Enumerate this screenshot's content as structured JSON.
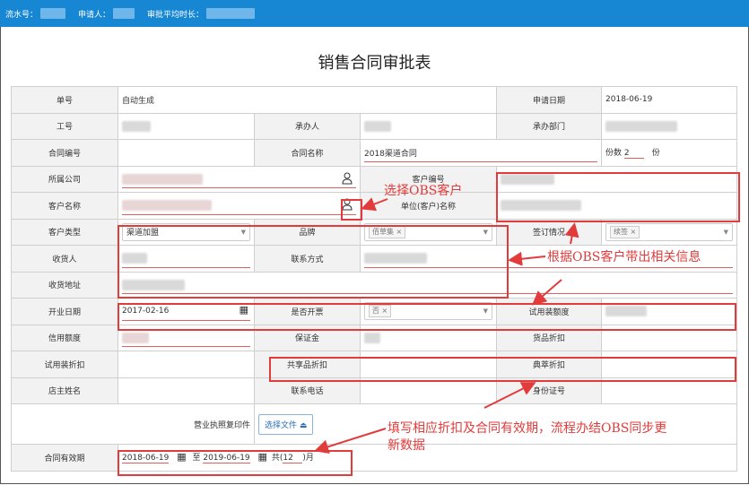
{
  "topbar": {
    "serial_label": "流水号：",
    "applicant_label": "申请人：",
    "avg_time_label": "审批平均时长："
  },
  "title": "销售合同审批表",
  "fields": {
    "order_no_label": "单号",
    "order_no_value": "自动生成",
    "apply_date_label": "申请日期",
    "apply_date_value": "2018-06-19",
    "emp_no_label": "工号",
    "handler_label": "承办人",
    "handler_dept_label": "承办部门",
    "contract_no_label": "合同编号",
    "contract_name_label": "合同名称",
    "contract_name_value": "2018渠道合同",
    "copies_label": "份数",
    "copies_value": "2",
    "copies_unit": "份",
    "company_label": "所属公司",
    "cust_no_label": "客户编号",
    "cust_name_label": "客户名称",
    "unit_name_label": "单位(客户)名称",
    "cust_type_label": "客户类型",
    "cust_type_value": "渠道加盟",
    "brand_label": "品牌",
    "brand_tag": "佰草集",
    "sign_label": "签订情况",
    "sign_tag": "续签",
    "receiver_label": "收货人",
    "contact_label": "联系方式",
    "address_label": "收货地址",
    "open_date_label": "开业日期",
    "open_date_value": "2017-02-16",
    "invoice_label": "是否开票",
    "invoice_tag": "否",
    "trial_amount_label": "试用装额度",
    "credit_label": "信用额度",
    "deposit_label": "保证金",
    "goods_discount_label": "货品折扣",
    "trial_discount_label": "试用装折扣",
    "shared_discount_label": "共享品折扣",
    "classic_discount_label": "典萃折扣",
    "owner_label": "店主姓名",
    "phone_label": "联系电话",
    "id_label": "身份证号",
    "license_label": "营业执照复印件",
    "upload_label": "选择文件",
    "validity_label": "合同有效期",
    "validity_from": "2018-06-19",
    "validity_to_word": "至",
    "validity_to": "2019-06-19",
    "validity_total_prefix": "共(",
    "validity_total_value": "12",
    "validity_total_suffix": ")月"
  },
  "annotations": {
    "select_obs": "选择OBS客户",
    "bring_info": "根据OBS客户带出相关信息",
    "fill_line1": "填写相应折扣及合同有效期，流程办结OBS同步更",
    "fill_line2": "新数据"
  },
  "colors": {
    "topbar": "#1787d4",
    "annotation": "#e23b3b",
    "label_bg": "#f2f2f2"
  }
}
